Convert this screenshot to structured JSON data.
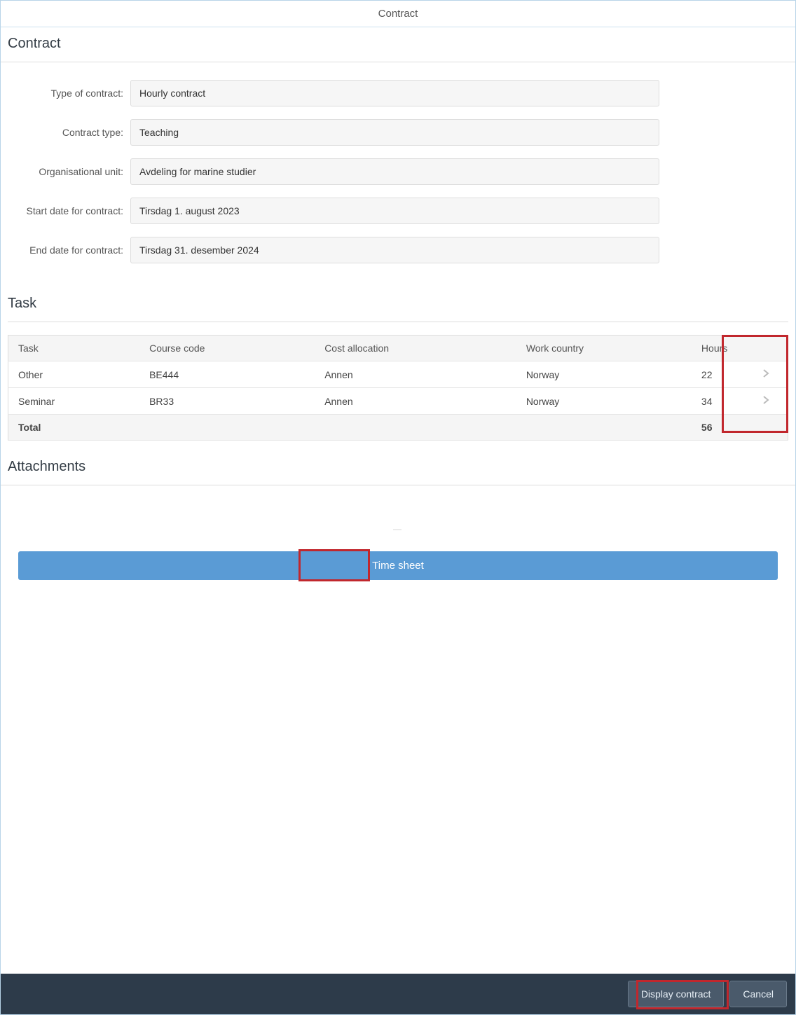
{
  "header": {
    "title": "Contract"
  },
  "section_contract": {
    "title": "Contract",
    "fields": {
      "type_of_contract": {
        "label": "Type of contract:",
        "value": "Hourly contract"
      },
      "contract_type": {
        "label": "Contract type:",
        "value": "Teaching"
      },
      "org_unit": {
        "label": "Organisational unit:",
        "value": "Avdeling for marine studier"
      },
      "start_date": {
        "label": "Start date for contract:",
        "value": "Tirsdag 1. august 2023"
      },
      "end_date": {
        "label": "End date for contract:",
        "value": "Tirsdag 31. desember 2024"
      }
    }
  },
  "section_task": {
    "title": "Task",
    "columns": {
      "task": "Task",
      "course_code": "Course code",
      "cost_allocation": "Cost allocation",
      "work_country": "Work country",
      "hours": "Hours"
    },
    "rows": [
      {
        "task": "Other",
        "course_code": "BE444",
        "cost_allocation": "Annen",
        "work_country": "Norway",
        "hours": "22"
      },
      {
        "task": "Seminar",
        "course_code": "BR33",
        "cost_allocation": "Annen",
        "work_country": "Norway",
        "hours": "34"
      }
    ],
    "total_label": "Total",
    "total_hours": "56"
  },
  "section_attachments": {
    "title": "Attachments"
  },
  "buttons": {
    "timesheet": "Time sheet",
    "display_contract": "Display contract",
    "cancel": "Cancel"
  }
}
